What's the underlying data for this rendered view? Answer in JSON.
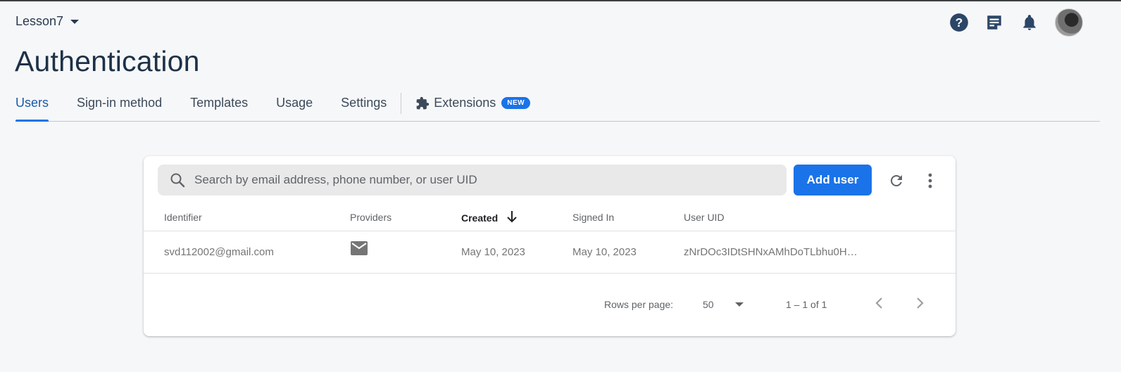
{
  "project": {
    "name": "Lesson7"
  },
  "page": {
    "title": "Authentication"
  },
  "tabs": [
    {
      "label": "Users",
      "active": true
    },
    {
      "label": "Sign-in method",
      "active": false
    },
    {
      "label": "Templates",
      "active": false
    },
    {
      "label": "Usage",
      "active": false
    },
    {
      "label": "Settings",
      "active": false
    }
  ],
  "extensions_tab": {
    "label": "Extensions",
    "badge": "NEW",
    "icon": "puzzle-icon"
  },
  "top_icons": [
    "help-icon",
    "release-notes-icon",
    "notifications-icon",
    "avatar"
  ],
  "search": {
    "placeholder": "Search by email address, phone number, or user UID",
    "value": ""
  },
  "toolbar": {
    "add_user_label": "Add user"
  },
  "table": {
    "columns": [
      "Identifier",
      "Providers",
      "Created",
      "Signed In",
      "User UID"
    ],
    "sorted_column": "Created",
    "sort_direction": "descending",
    "rows": [
      {
        "identifier": "svd112002@gmail.com",
        "provider_icon": "email-icon",
        "created": "May 10, 2023",
        "signed_in": "May 10, 2023",
        "uid": "zNrDOc3IDtSHNxAMhDoTLbhu0H…"
      }
    ]
  },
  "pagination": {
    "rows_per_page_label": "Rows per page:",
    "rows_per_page": "50",
    "range": "1 – 1 of 1"
  },
  "colors": {
    "accent": "#1a73e8",
    "title": "#1d3146",
    "background": "#f6f7f9"
  }
}
